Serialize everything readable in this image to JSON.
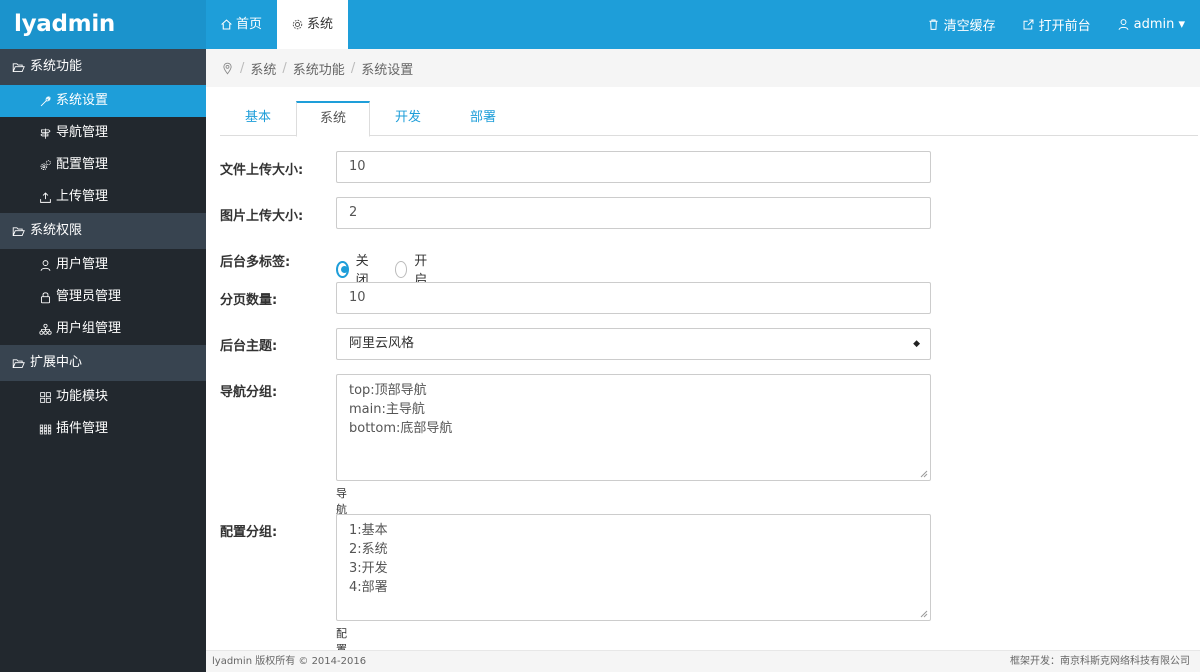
{
  "header": {
    "logo": "lyadmin",
    "nav": [
      {
        "label": "首页",
        "icon": "home-icon"
      },
      {
        "label": "系统",
        "icon": "gear-icon",
        "active": true
      }
    ],
    "right": [
      {
        "label": "清空缓存",
        "icon": "trash-icon"
      },
      {
        "label": "打开前台",
        "icon": "external-link-icon"
      },
      {
        "label": "admin ▾",
        "icon": "user-icon"
      }
    ]
  },
  "sidebar": {
    "groups": [
      {
        "label": "系统功能",
        "icon": "folder-open-icon",
        "items": [
          {
            "label": "系统设置",
            "icon": "wrench-icon",
            "active": true
          },
          {
            "label": "导航管理",
            "icon": "signpost-icon"
          },
          {
            "label": "配置管理",
            "icon": "cogs-icon"
          },
          {
            "label": "上传管理",
            "icon": "upload-icon"
          }
        ]
      },
      {
        "label": "系统权限",
        "icon": "folder-open-icon",
        "items": [
          {
            "label": "用户管理",
            "icon": "user-icon"
          },
          {
            "label": "管理员管理",
            "icon": "lock-icon"
          },
          {
            "label": "用户组管理",
            "icon": "sitemap-icon"
          }
        ]
      },
      {
        "label": "扩展中心",
        "icon": "folder-open-icon",
        "items": [
          {
            "label": "功能模块",
            "icon": "grid-icon"
          },
          {
            "label": "插件管理",
            "icon": "apps-icon"
          }
        ]
      }
    ]
  },
  "breadcrumb": {
    "icon": "location-pin-icon",
    "items": [
      "系统",
      "系统功能",
      "系统设置"
    ]
  },
  "tabs": [
    "基本",
    "系统",
    "开发",
    "部署"
  ],
  "active_tab": "系统",
  "form": {
    "upload_file_size": {
      "label": "文件上传大小:",
      "value": "10"
    },
    "upload_image_size": {
      "label": "图片上传大小:",
      "value": "2"
    },
    "multi_tab": {
      "label": "后台多标签:",
      "options": [
        "关闭",
        "开启"
      ],
      "selected": "关闭"
    },
    "page_size": {
      "label": "分页数量:",
      "value": "10"
    },
    "theme": {
      "label": "后台主题:",
      "value": "阿里云风格"
    },
    "nav_groups": {
      "label": "导航分组:",
      "lines": [
        "top:顶部导航",
        "main:主导航",
        "bottom:底部导航"
      ],
      "help": "导航分组"
    },
    "config_groups": {
      "label": "配置分组:",
      "lines": [
        "1:基本",
        "2:系统",
        "3:开发",
        "4:部署"
      ],
      "help": "配置分组"
    }
  },
  "footer": {
    "left": "lyadmin  版权所有 © 2014-2016",
    "right": "框架开发：南京科斯克网络科技有限公司"
  },
  "colors": {
    "primary": "#1e9ed9",
    "sidebar": "#22282e",
    "sidebar_group": "#384450"
  }
}
